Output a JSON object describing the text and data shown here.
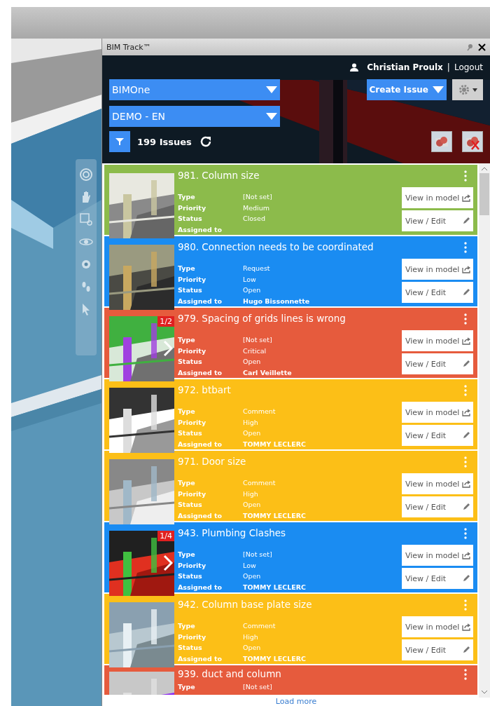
{
  "panel": {
    "title": "BIM Track™"
  },
  "header": {
    "user": "Christian Proulx",
    "separator": "|",
    "logout": "Logout",
    "project_select": "BIMOne",
    "team_select": "DEMO - EN",
    "create_button": "Create Issue",
    "issue_count": "199 Issues"
  },
  "issues": [
    {
      "title": "981. Column size",
      "color": "#8cbb4b",
      "fields": [
        {
          "label": "Type",
          "value": "[Not set]"
        },
        {
          "label": "Priority",
          "value": "Medium"
        },
        {
          "label": "Status",
          "value": "Closed"
        },
        {
          "label": "Assigned to"
        }
      ],
      "actions": [
        "View in model",
        "View / Edit"
      ]
    },
    {
      "title": "980. Connection needs to be coordinated",
      "color": "#1a8cf2",
      "fields": [
        {
          "label": "Type",
          "value": "Request"
        },
        {
          "label": "Priority",
          "value": "Low"
        },
        {
          "label": "Status",
          "value": "Open"
        },
        {
          "label": "Assigned to",
          "value": "Hugo Bissonnette"
        }
      ],
      "actions": [
        "View in model",
        "View / Edit"
      ]
    },
    {
      "title": "979. Spacing of grids lines is wrong",
      "color": "#e65b3d",
      "pager": "1/2",
      "fields": [
        {
          "label": "Type",
          "value": "[Not set]"
        },
        {
          "label": "Priority",
          "value": "Critical"
        },
        {
          "label": "Status",
          "value": "Open"
        },
        {
          "label": "Assigned to",
          "value": "Carl Veillette"
        }
      ],
      "actions": [
        "View in model",
        "View / Edit"
      ]
    },
    {
      "title": "972. btbart",
      "color": "#fcbf17",
      "fields": [
        {
          "label": "Type",
          "value": "Comment"
        },
        {
          "label": "Priority",
          "value": "High"
        },
        {
          "label": "Status",
          "value": "Open"
        },
        {
          "label": "Assigned to",
          "value": "TOMMY LECLERC"
        }
      ],
      "actions": [
        "View in model",
        "View / Edit"
      ]
    },
    {
      "title": "971. Door size",
      "color": "#fcbf17",
      "fields": [
        {
          "label": "Type",
          "value": "Comment"
        },
        {
          "label": "Priority",
          "value": "High"
        },
        {
          "label": "Status",
          "value": "Open"
        },
        {
          "label": "Assigned to",
          "value": "TOMMY LECLERC"
        }
      ],
      "actions": [
        "View in model",
        "View / Edit"
      ]
    },
    {
      "title": "943. Plumbing Clashes",
      "color": "#1a8cf2",
      "pager": "1/4",
      "fields": [
        {
          "label": "Type",
          "value": "[Not set]"
        },
        {
          "label": "Priority",
          "value": "Low"
        },
        {
          "label": "Status",
          "value": "Open"
        },
        {
          "label": "Assigned to",
          "value": "TOMMY LECLERC"
        }
      ],
      "actions": [
        "View in model",
        "View / Edit"
      ]
    },
    {
      "title": "942. Column base plate size",
      "color": "#fcbf17",
      "fields": [
        {
          "label": "Type",
          "value": "Comment"
        },
        {
          "label": "Priority",
          "value": "High"
        },
        {
          "label": "Status",
          "value": "Open"
        },
        {
          "label": "Assigned to",
          "value": "TOMMY LECLERC"
        }
      ],
      "actions": [
        "View in model",
        "View / Edit"
      ]
    },
    {
      "title": "939. duct and column",
      "color": "#e65b3d",
      "fields": [
        {
          "label": "Type",
          "value": "[Not set]"
        }
      ]
    }
  ],
  "load_more": "Load more"
}
